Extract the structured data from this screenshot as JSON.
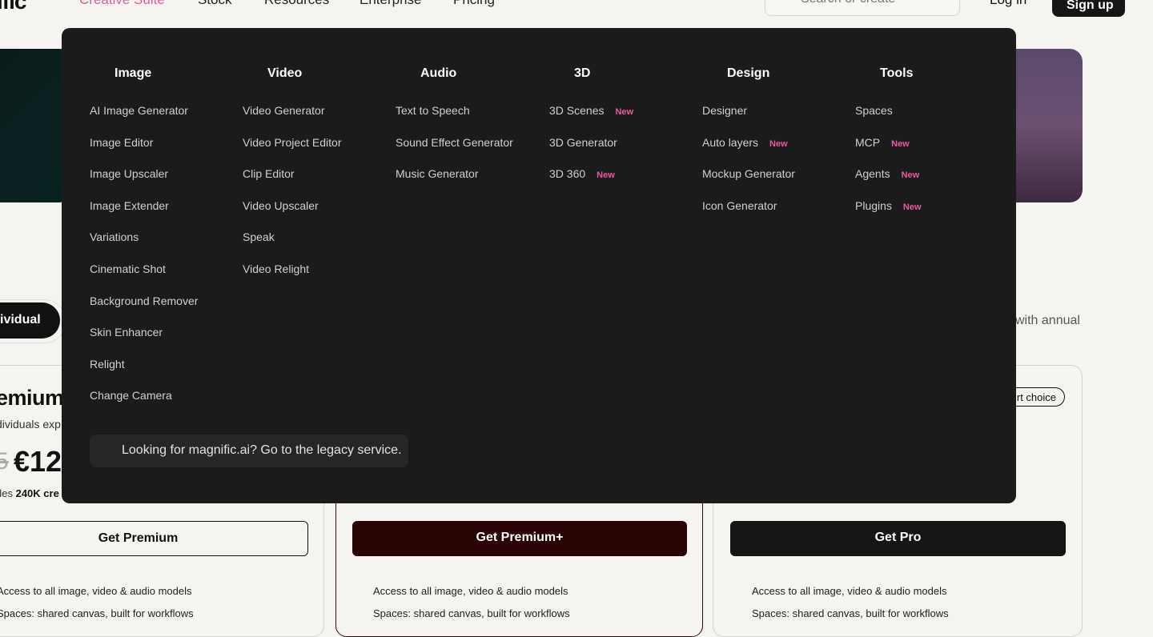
{
  "nav": {
    "logo": "ific",
    "links": [
      "Creative Suite",
      "Stock",
      "Resources",
      "Enterprise",
      "Pricing"
    ],
    "search_placeholder": "Search or create",
    "login": "Log in",
    "signup": "Sign up"
  },
  "toggle": {
    "individual": "ividual",
    "annual": "with annual"
  },
  "cards": {
    "premium_title": "emium",
    "premium_sub": "dividuals exp",
    "old_price": "5",
    "price": "€12",
    "credits_prefix": "des",
    "credits_bold": "240K",
    "credits_suffix": "cre",
    "smart_choice": "rt choice",
    "buttons": [
      "Get Premium",
      "Get Premium+",
      "Get Pro"
    ],
    "feature_1": "Access to all image, video & audio models",
    "feature_2": "Spaces: shared canvas, built for workflows"
  },
  "menu": {
    "columns": [
      {
        "title": "Image",
        "items": [
          {
            "label": "AI Image Generator"
          },
          {
            "label": "Image Editor"
          },
          {
            "label": "Image Upscaler"
          },
          {
            "label": "Image Extender"
          },
          {
            "label": "Variations"
          },
          {
            "label": "Cinematic Shot"
          },
          {
            "label": "Background Remover"
          },
          {
            "label": "Skin Enhancer"
          },
          {
            "label": "Relight"
          },
          {
            "label": "Change Camera"
          }
        ]
      },
      {
        "title": "Video",
        "items": [
          {
            "label": "Video Generator"
          },
          {
            "label": "Video Project Editor"
          },
          {
            "label": "Clip Editor"
          },
          {
            "label": "Video Upscaler"
          },
          {
            "label": "Speak"
          },
          {
            "label": "Video Relight"
          }
        ]
      },
      {
        "title": "Audio",
        "items": [
          {
            "label": "Text to Speech"
          },
          {
            "label": "Sound Effect Generator"
          },
          {
            "label": "Music Generator"
          }
        ]
      },
      {
        "title": "3D",
        "items": [
          {
            "label": "3D Scenes",
            "badge": "New"
          },
          {
            "label": "3D Generator"
          },
          {
            "label": "3D 360",
            "badge": "New"
          }
        ]
      },
      {
        "title": "Design",
        "items": [
          {
            "label": "Designer"
          },
          {
            "label": "Auto layers",
            "badge": "New"
          },
          {
            "label": "Mockup Generator"
          },
          {
            "label": "Icon Generator"
          }
        ]
      },
      {
        "title": "Tools",
        "items": [
          {
            "label": "Spaces"
          },
          {
            "label": "MCP",
            "badge": "New"
          },
          {
            "label": "Agents",
            "badge": "New"
          },
          {
            "label": "Plugins",
            "badge": "New"
          }
        ]
      }
    ],
    "legacy": "Looking for magnific.ai? Go to the legacy service."
  },
  "colors": {
    "accent": "#e85aa2",
    "menu_bg": "#1b1b1b",
    "premium_plus": "#2a0404"
  }
}
